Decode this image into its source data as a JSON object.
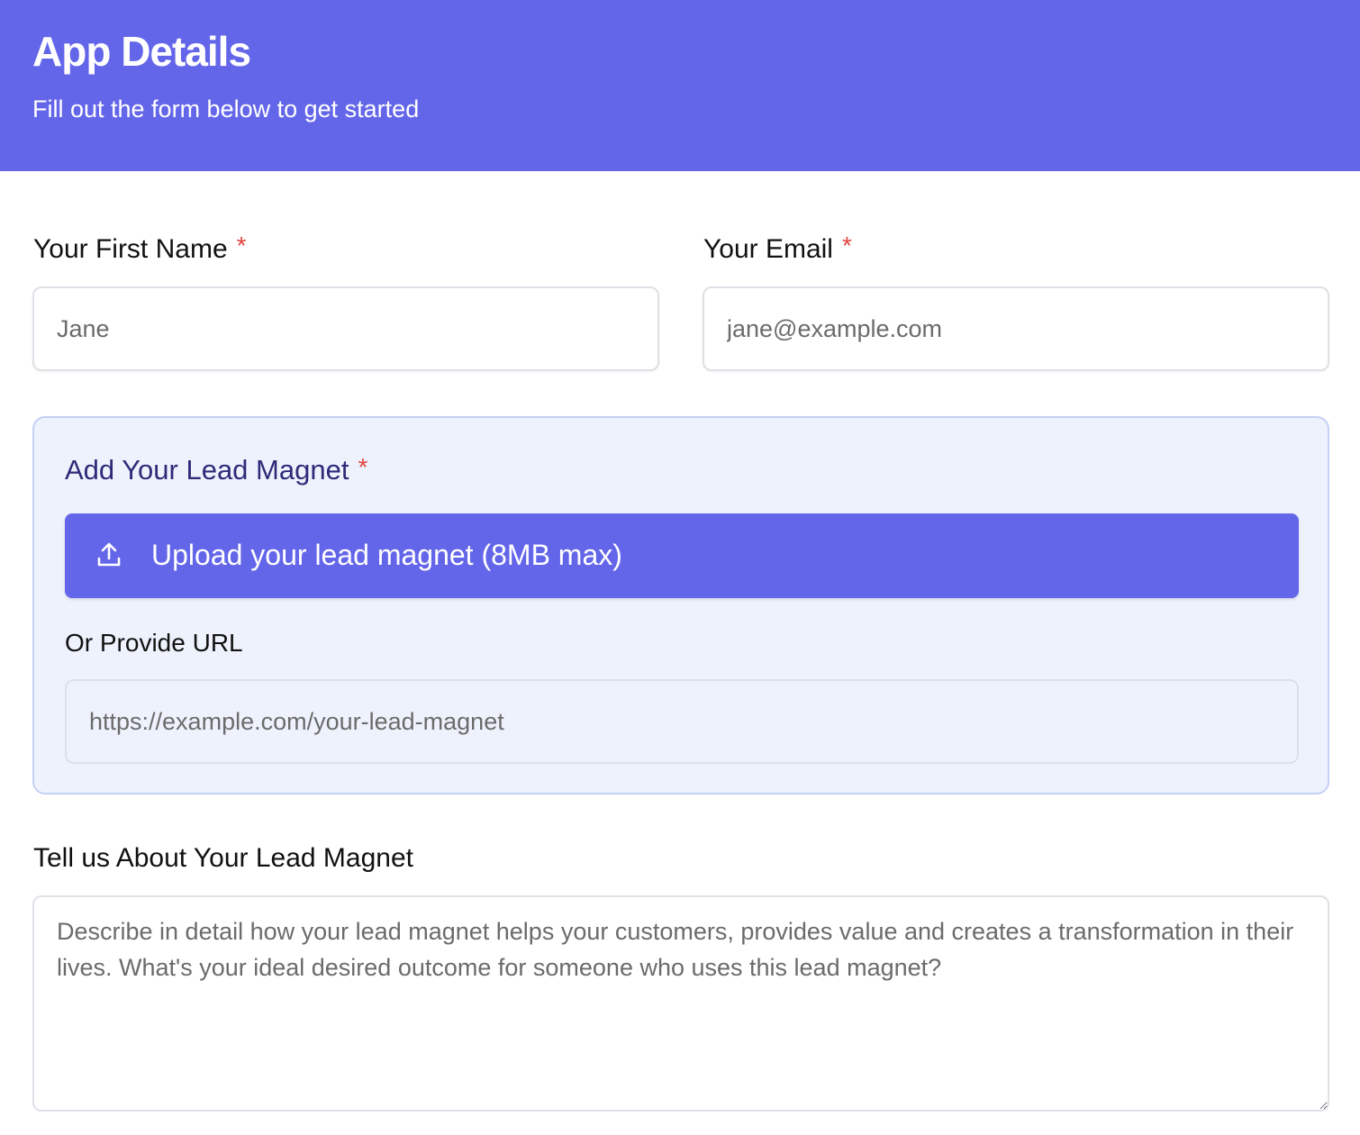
{
  "header": {
    "title": "App Details",
    "subtitle": "Fill out the form below to get started"
  },
  "form": {
    "first_name": {
      "label": "Your First Name",
      "required_mark": "*",
      "placeholder": "Jane",
      "value": ""
    },
    "email": {
      "label": "Your Email",
      "required_mark": "*",
      "placeholder": "jane@example.com",
      "value": ""
    },
    "lead_magnet": {
      "title": "Add Your Lead Magnet",
      "required_mark": "*",
      "upload_label": "Upload your lead magnet (8MB max)",
      "upload_icon": "upload-icon",
      "url_label": "Or Provide URL",
      "url_placeholder": "https://example.com/your-lead-magnet"
    },
    "about": {
      "label": "Tell us About Your Lead Magnet",
      "placeholder": "Describe in detail how your lead magnet helps your customers, provides value and creates a transformation in their lives. What's your ideal desired outcome for someone who uses this lead magnet?"
    }
  },
  "colors": {
    "brand": "#6466ea",
    "required": "#e0443e",
    "lead_panel_bg": "#eef2fd",
    "lead_title": "#2e2b78"
  }
}
